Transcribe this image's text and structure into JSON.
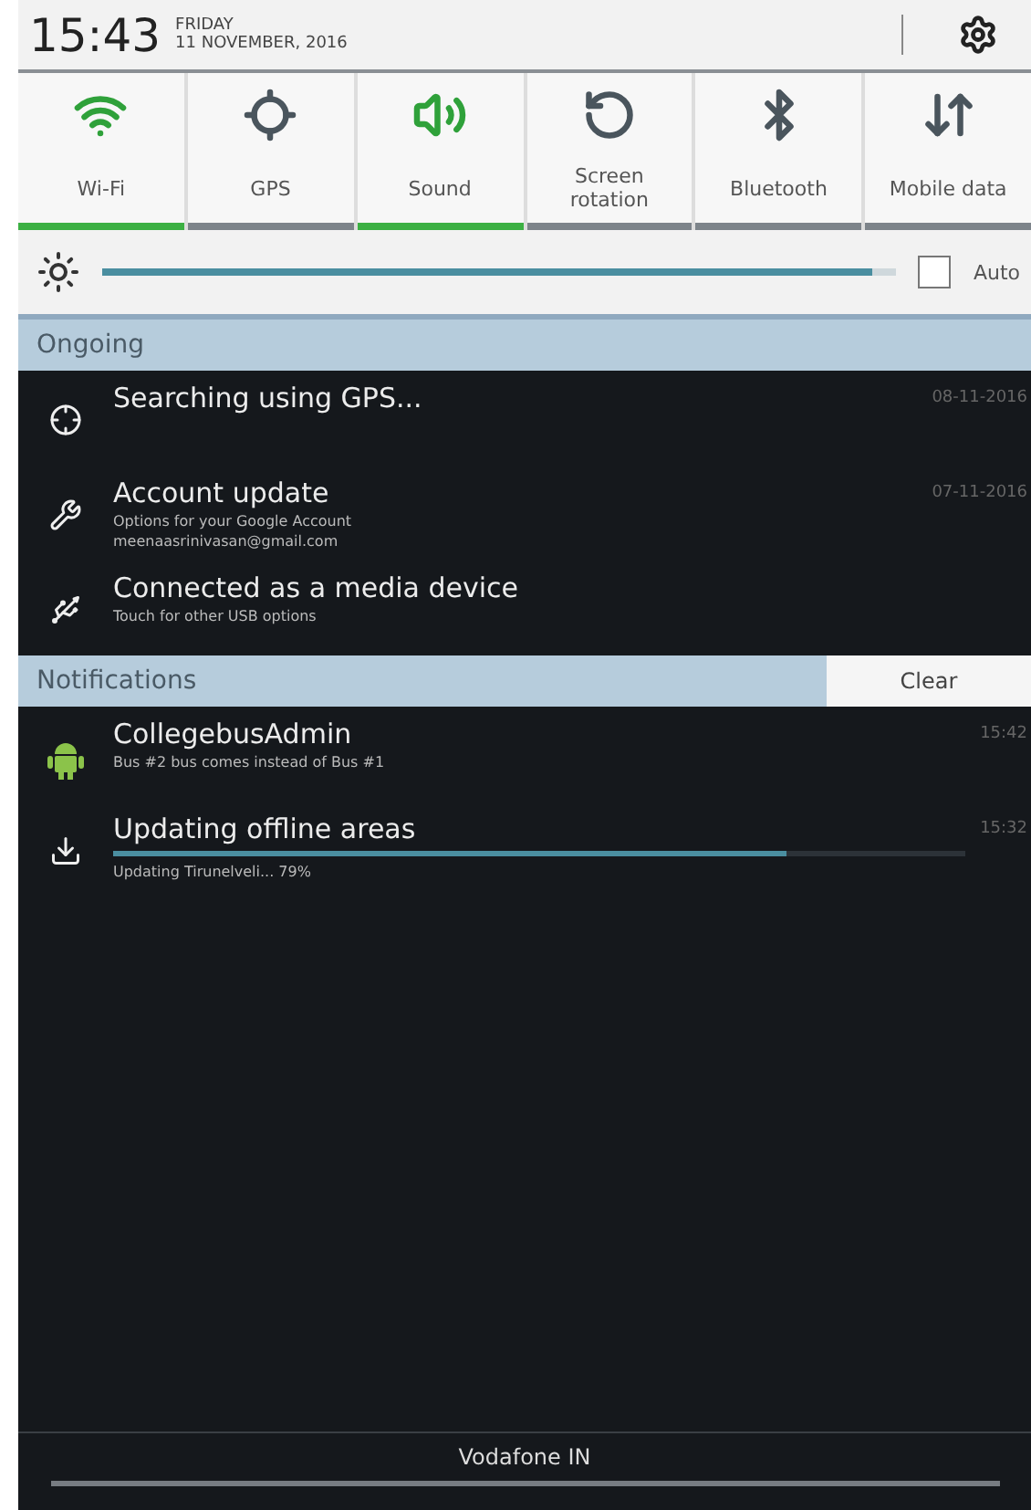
{
  "status": {
    "time": "15:43",
    "day": "FRIDAY",
    "date": "11 NOVEMBER, 2016"
  },
  "toggles": [
    {
      "kind": "wifi",
      "label": "Wi-Fi",
      "on": true
    },
    {
      "kind": "gps",
      "label": "GPS",
      "on": false
    },
    {
      "kind": "sound",
      "label": "Sound",
      "on": true
    },
    {
      "kind": "rotation",
      "label": "Screen rotation",
      "on": false
    },
    {
      "kind": "bluetooth",
      "label": "Bluetooth",
      "on": false
    },
    {
      "kind": "data",
      "label": "Mobile data",
      "on": false
    }
  ],
  "brightness": {
    "level": 0.97,
    "auto_label": "Auto",
    "auto_checked": false
  },
  "ongoing": {
    "title": "Ongoing",
    "items": [
      {
        "kind": "gps",
        "title": "Searching using GPS...",
        "time": "08-11-2016"
      },
      {
        "kind": "wrench",
        "title": "Account update",
        "time": "07-11-2016",
        "lines": [
          "Options for your Google Account",
          "meenaasrinivasan@gmail.com"
        ]
      },
      {
        "kind": "usb",
        "title": "Connected as a media device",
        "lines": [
          "Touch for other USB options"
        ]
      }
    ]
  },
  "notifications": {
    "title": "Notifications",
    "clear": "Clear",
    "items": [
      {
        "kind": "android",
        "title": "CollegebusAdmin",
        "time": "15:42",
        "lines": [
          "Bus #2 bus comes instead of Bus #1"
        ]
      },
      {
        "kind": "download",
        "title": "Updating offline areas",
        "time": "15:32",
        "level": 0.79,
        "lines": [
          "Updating Tirunelveli... 79%"
        ]
      }
    ]
  },
  "carrier": "Vodafone IN"
}
